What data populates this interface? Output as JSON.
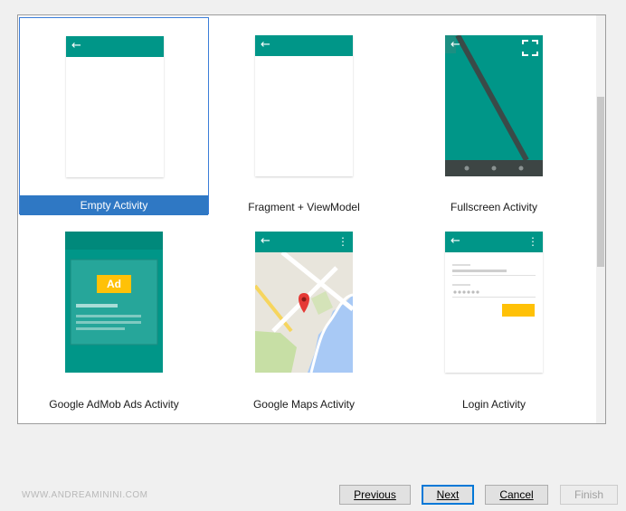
{
  "gallery": {
    "templates": [
      {
        "label": "Empty Activity",
        "selected": true
      },
      {
        "label": "Fragment + ViewModel",
        "selected": false
      },
      {
        "label": "Fullscreen Activity",
        "selected": false
      },
      {
        "label": "Google AdMob Ads Activity",
        "selected": false
      },
      {
        "label": "Google Maps Activity",
        "selected": false
      },
      {
        "label": "Login Activity",
        "selected": false
      }
    ],
    "ad_badge": "Ad"
  },
  "footer": {
    "watermark": "WWW.ANDREAMININI.COM",
    "previous_label": "Previous",
    "next_label": "Next",
    "cancel_label": "Cancel",
    "finish_label": "Finish"
  },
  "icons": {
    "back": "arrow-left-icon",
    "overflow": "more-vert-icon",
    "fullscreen": "fullscreen-icon",
    "map_pin": "map-pin-icon"
  },
  "colors": {
    "teal": "#009688",
    "selection": "#2f78c4",
    "ad_yellow": "#ffc107",
    "pin_red": "#e53935"
  }
}
